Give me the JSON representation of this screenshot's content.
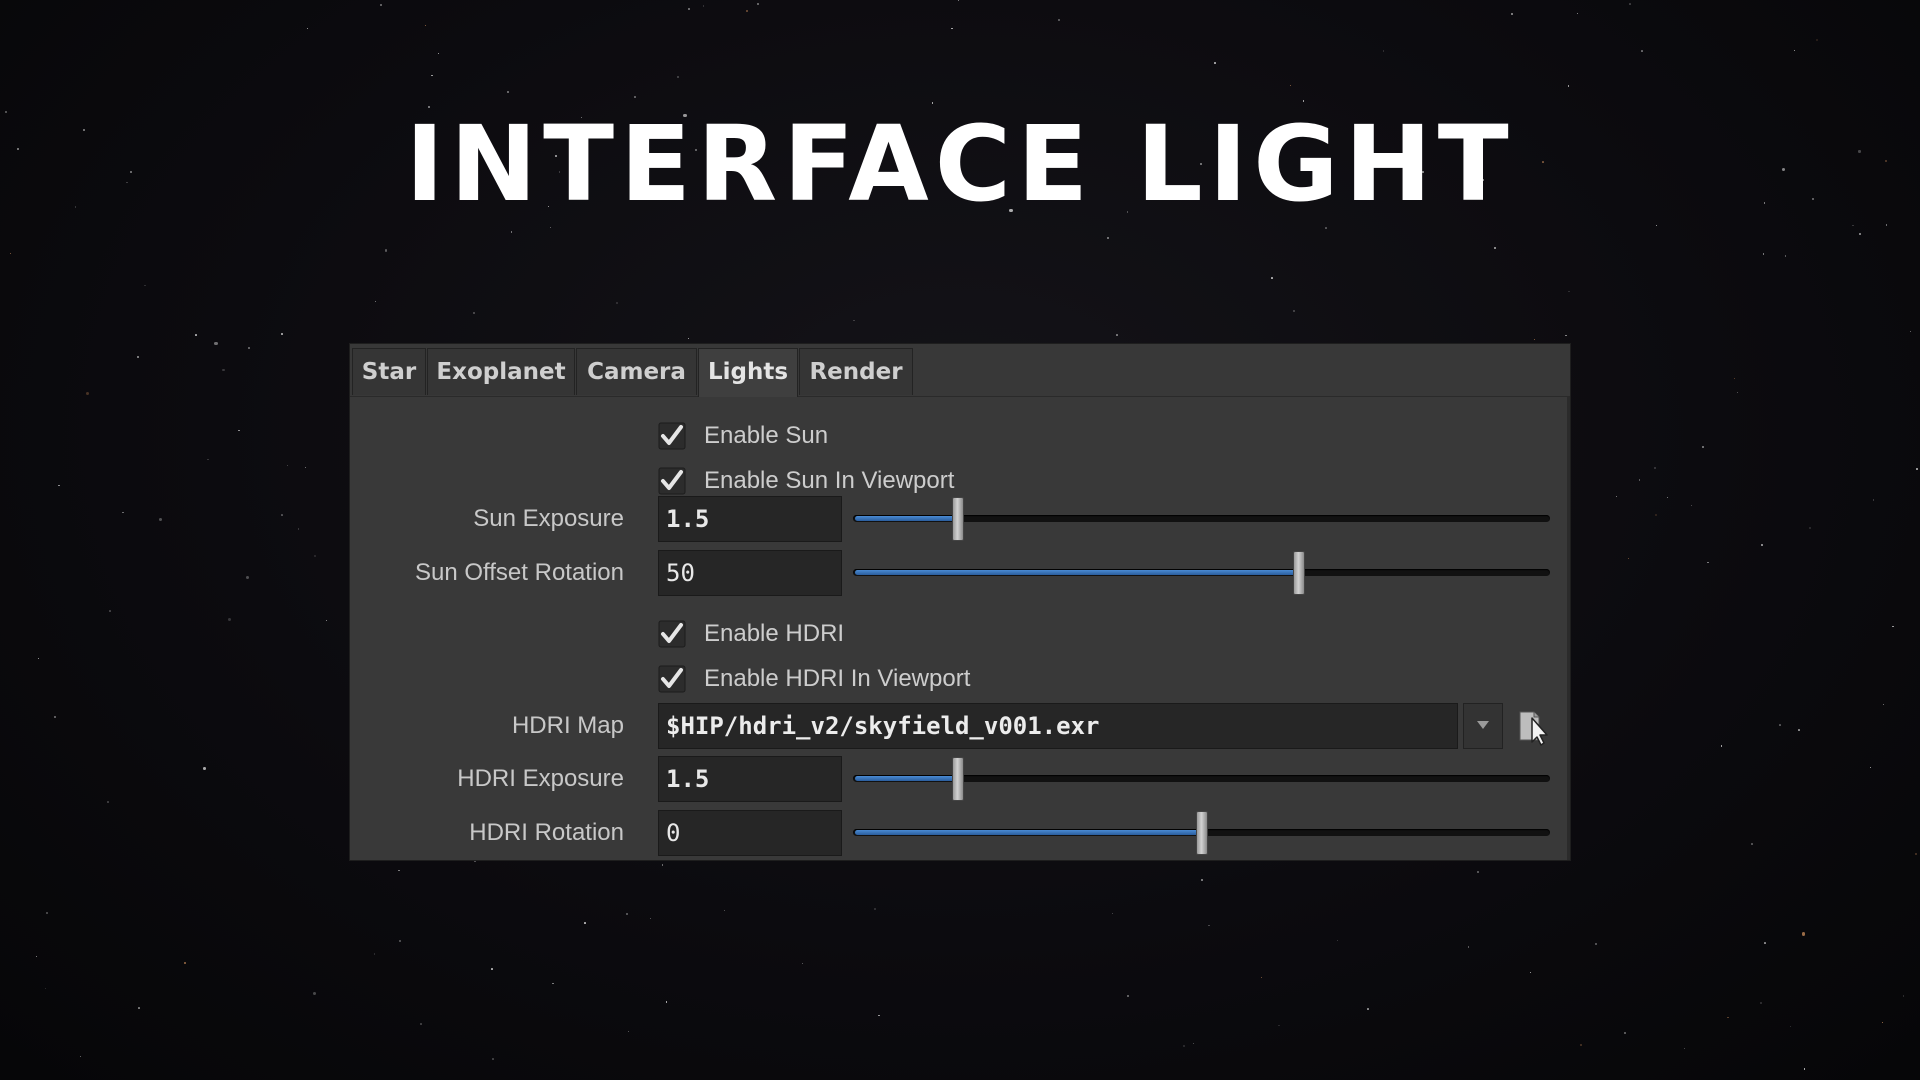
{
  "heading": "INTERFACE LIGHT",
  "tabs": [
    {
      "label": "Star",
      "active": false
    },
    {
      "label": "Exoplanet",
      "active": false
    },
    {
      "label": "Camera",
      "active": false
    },
    {
      "label": "Lights",
      "active": true
    },
    {
      "label": "Render",
      "active": false
    }
  ],
  "lights": {
    "enable_sun": {
      "label": "Enable Sun",
      "checked": true
    },
    "enable_sun_viewport": {
      "label": "Enable Sun In Viewport",
      "checked": true
    },
    "sun_exposure": {
      "label": "Sun Exposure",
      "value": "1.5",
      "slider_fraction": 0.15
    },
    "sun_offset_rotation": {
      "label": "Sun Offset Rotation",
      "value": "50",
      "slider_fraction": 0.64
    },
    "enable_hdri": {
      "label": "Enable HDRI",
      "checked": true
    },
    "enable_hdri_viewport": {
      "label": "Enable HDRI In Viewport",
      "checked": true
    },
    "hdri_map": {
      "label": "HDRI Map",
      "value": "$HIP/hdri_v2/skyfield_v001.exr"
    },
    "hdri_exposure": {
      "label": "HDRI Exposure",
      "value": "1.5",
      "slider_fraction": 0.15
    },
    "hdri_rotation": {
      "label": "HDRI Rotation",
      "value": "0",
      "slider_fraction": 0.5
    }
  },
  "icons": {
    "checkbox": "checkmark-icon",
    "dropdown": "chevron-down-icon",
    "browse": "file-browse-icon"
  },
  "colors": {
    "slider_fill": "#3b78c2",
    "panel_bg": "#393939",
    "field_bg": "#262626"
  }
}
